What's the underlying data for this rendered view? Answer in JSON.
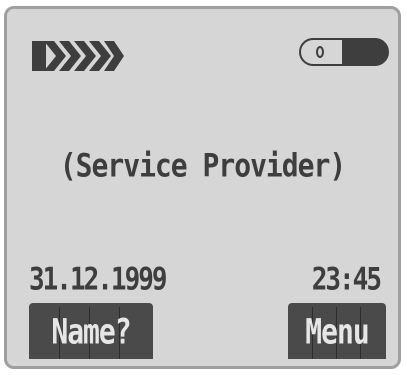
{
  "status_bar": {
    "signal_icon": "signal-strength-icon",
    "signal_level": 5,
    "battery_icon": "battery-icon"
  },
  "main": {
    "provider_text": "(Service Provider)"
  },
  "info_row": {
    "date": "31.12.1999",
    "time": "23:45"
  },
  "softkeys": {
    "left_label": "Name?",
    "right_label": "Menu"
  },
  "colors": {
    "screen_bg": "#d6d6d6",
    "text": "#3e3e3e",
    "softkey_bg": "#4a4a4a",
    "softkey_text": "#e6e6e6"
  }
}
